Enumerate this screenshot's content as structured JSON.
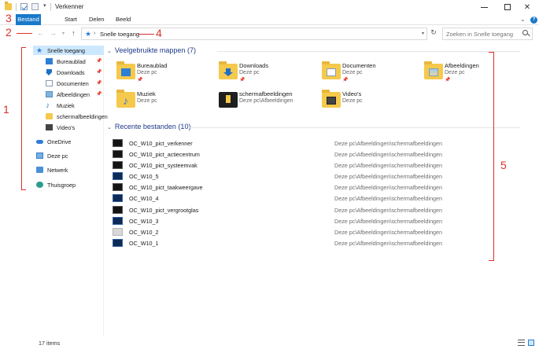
{
  "window": {
    "title": "Verkenner"
  },
  "ribbon": {
    "tabs": [
      "Bestand",
      "Start",
      "Delen",
      "Beeld"
    ]
  },
  "address": {
    "path": "Snelle toegang",
    "search_placeholder": "Zoeken in Snelle toegang"
  },
  "sidebar": {
    "items": [
      {
        "label": "Snelle toegang",
        "icon": "star-icon",
        "selected": true
      },
      {
        "label": "Bureaublad",
        "icon": "desktop-icon",
        "pinned": true
      },
      {
        "label": "Downloads",
        "icon": "download-icon",
        "pinned": true
      },
      {
        "label": "Documenten",
        "icon": "document-icon",
        "pinned": true
      },
      {
        "label": "Afbeeldingen",
        "icon": "picture-icon",
        "pinned": true
      },
      {
        "label": "Muziek",
        "icon": "music-icon"
      },
      {
        "label": "schermafbeeldingen",
        "icon": "folder-icon"
      },
      {
        "label": "Video's",
        "icon": "video-icon"
      },
      {
        "label": "OneDrive",
        "icon": "cloud-icon"
      },
      {
        "label": "Deze pc",
        "icon": "computer-icon"
      },
      {
        "label": "Netwerk",
        "icon": "network-icon"
      },
      {
        "label": "Thuisgroep",
        "icon": "homegroup-icon"
      }
    ]
  },
  "frequent": {
    "heading": "Veelgebruikte mappen (7)",
    "items": [
      {
        "name": "Bureaublad",
        "location": "Deze pc",
        "icon": "desktop-folder-icon",
        "pinned": true
      },
      {
        "name": "Downloads",
        "location": "Deze pc",
        "icon": "downloads-folder-icon",
        "pinned": true
      },
      {
        "name": "Documenten",
        "location": "Deze pc",
        "icon": "documents-folder-icon",
        "pinned": true
      },
      {
        "name": "Afbeeldingen",
        "location": "Deze pc",
        "icon": "pictures-folder-icon",
        "pinned": true
      },
      {
        "name": "Muziek",
        "location": "Deze pc",
        "icon": "music-folder-icon",
        "pinned": false
      },
      {
        "name": "schermafbeeldingen",
        "location": "Deze pc\\Afbeeldingen",
        "icon": "screenshots-folder-icon",
        "pinned": false
      },
      {
        "name": "Video's",
        "location": "Deze pc",
        "icon": "videos-folder-icon",
        "pinned": false
      }
    ]
  },
  "recent": {
    "heading": "Recente bestanden (10)",
    "files": [
      {
        "name": "OC_W10_pict_verkenner",
        "path": "Deze pc\\Afbeeldingen\\schermafbeeldingen"
      },
      {
        "name": "OC_W10_pict_actiecentrum",
        "path": "Deze pc\\Afbeeldingen\\schermafbeeldingen"
      },
      {
        "name": "OC_W10_pict_systeemvak",
        "path": "Deze pc\\Afbeeldingen\\schermafbeeldingen"
      },
      {
        "name": "OC_W10_5",
        "path": "Deze pc\\Afbeeldingen\\schermafbeeldingen"
      },
      {
        "name": "OC_W10_pict_taakweergave",
        "path": "Deze pc\\Afbeeldingen\\schermafbeeldingen"
      },
      {
        "name": "OC_W10_4",
        "path": "Deze pc\\Afbeeldingen\\schermafbeeldingen"
      },
      {
        "name": "OC_W10_pict_vergrootglas",
        "path": "Deze pc\\Afbeeldingen\\schermafbeeldingen"
      },
      {
        "name": "OC_W10_3",
        "path": "Deze pc\\Afbeeldingen\\schermafbeeldingen"
      },
      {
        "name": "OC_W10_2",
        "path": "Deze pc\\Afbeeldingen\\schermafbeeldingen"
      },
      {
        "name": "OC_W10_1",
        "path": "Deze pc\\Afbeeldingen\\schermafbeeldingen"
      }
    ]
  },
  "status": {
    "count": "17 items"
  },
  "annotations": [
    "1",
    "2",
    "3",
    "4",
    "5"
  ],
  "colors": {
    "accent": "#1979ca",
    "annotation": "#d9312b",
    "selection": "#cce8ff",
    "heading": "#1e3a8a"
  }
}
